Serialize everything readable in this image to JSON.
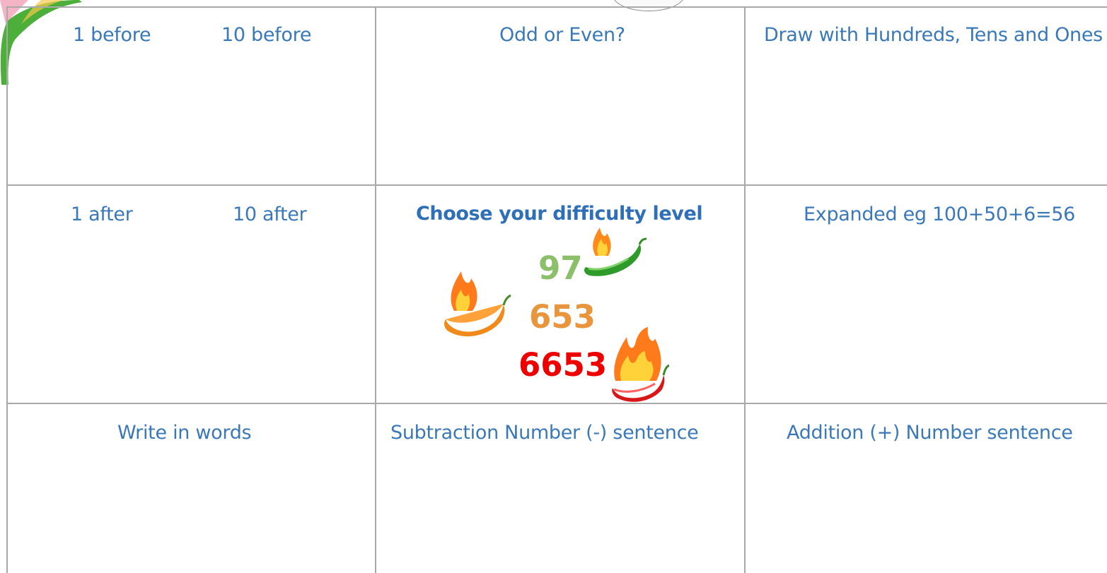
{
  "grid": {
    "top_row": {
      "left": {
        "label_a": "1 before",
        "label_b": "10 before"
      },
      "middle": {
        "label": "Odd or Even?"
      },
      "right": {
        "label": "Draw with Hundreds, Tens and Ones"
      }
    },
    "middle_row": {
      "left": {
        "label_a": "1 after",
        "label_b": "10 after"
      },
      "middle": {
        "title": "Choose your difficulty level",
        "levels": [
          {
            "number": "97",
            "color": "#8cbf6a",
            "pepper": "green-chili-icon"
          },
          {
            "number": "653",
            "color": "#e8953d",
            "pepper": "orange-chili-icon"
          },
          {
            "number": "6653",
            "color": "#ee0000",
            "pepper": "red-chili-icon"
          }
        ]
      },
      "right": {
        "label": "Expanded eg 100+50+6=56"
      }
    },
    "bottom_row": {
      "left": {
        "label": "Write in words"
      },
      "middle": {
        "label": "Subtraction Number (-) sentence"
      },
      "right": {
        "label": "Addition (+) Number sentence"
      }
    }
  },
  "colors": {
    "text": "#3a78b8",
    "grid_line": "#a9a9a9"
  }
}
